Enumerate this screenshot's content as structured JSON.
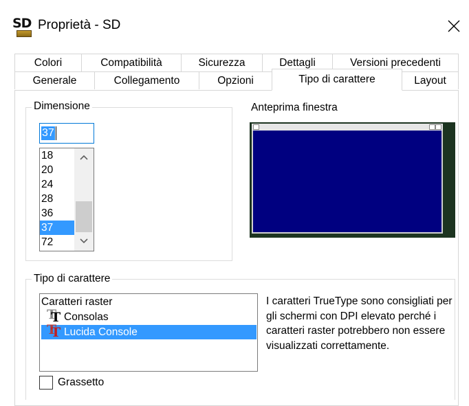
{
  "window": {
    "title": "Proprietà - SD",
    "icon": "sd-app-icon",
    "icon_text": "SD",
    "close_icon": "close-icon"
  },
  "tabs": {
    "row1": [
      {
        "label": "Colori"
      },
      {
        "label": "Compatibilità"
      },
      {
        "label": "Sicurezza"
      },
      {
        "label": "Dettagli"
      },
      {
        "label": "Versioni precedenti"
      }
    ],
    "row2": [
      {
        "label": "Generale"
      },
      {
        "label": "Collegamento"
      },
      {
        "label": "Opzioni"
      },
      {
        "label": "Tipo di carattere",
        "active": true
      },
      {
        "label": "Layout"
      }
    ]
  },
  "size_group": {
    "legend": "Dimensione",
    "input_value": "37",
    "options": [
      "18",
      "20",
      "24",
      "28",
      "36",
      "37",
      "72"
    ],
    "selected": "37"
  },
  "preview": {
    "label": "Anteprima finestra",
    "window_color": "#000080"
  },
  "font_group": {
    "legend": "Tipo di carattere",
    "fonts": [
      {
        "label": "Caratteri raster",
        "icon": "none"
      },
      {
        "label": "Consolas",
        "icon": "truetype-icon"
      },
      {
        "label": "Lucida Console",
        "icon": "truetype-icon",
        "selected": true
      }
    ],
    "info": "I caratteri TrueType sono consigliati per gli schermi con DPI elevato perché i caratteri raster potrebbero non essere visualizzati correttamente.",
    "bold_label": "Grassetto",
    "bold_checked": false
  },
  "colors": {
    "selection": "#3399ff",
    "focus_border": "#0078d7"
  }
}
